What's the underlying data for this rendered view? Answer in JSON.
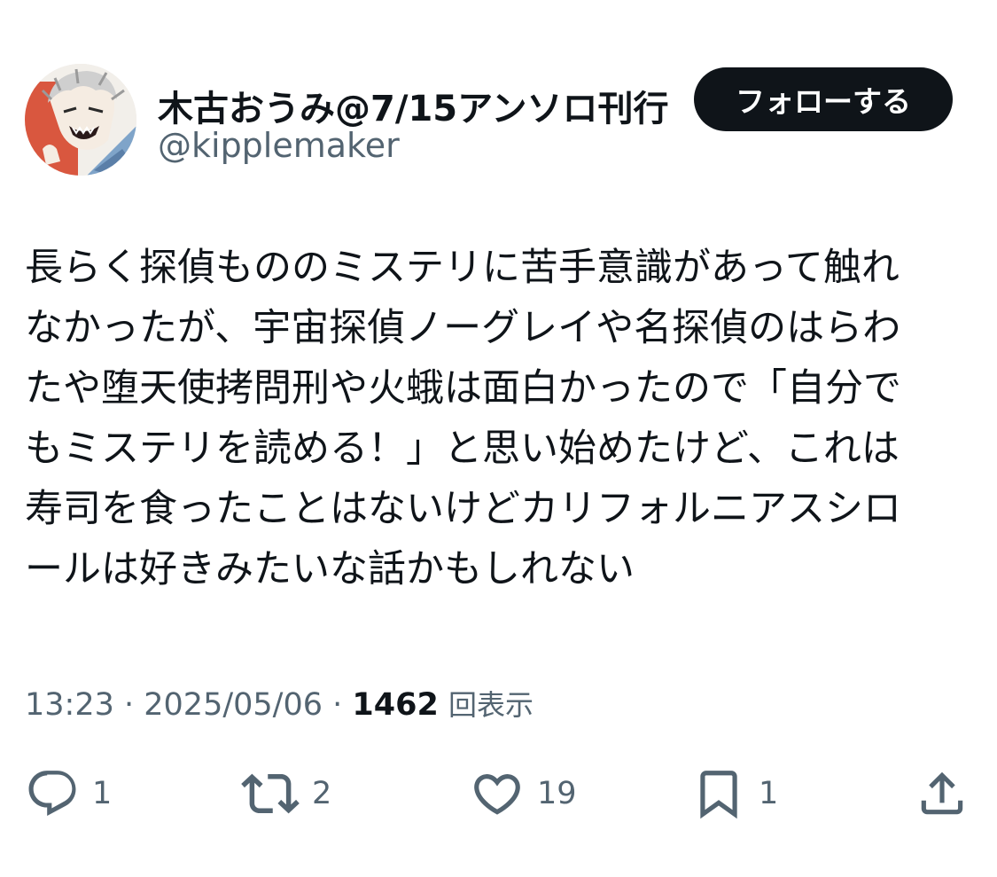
{
  "user": {
    "display_name": "木古おうみ@7/15アンソロ刊行",
    "handle": "@kipplemaker"
  },
  "follow_button": {
    "label": "フォローする"
  },
  "post": {
    "lines": [
      "長らく探偵もののミステリに苦手意識があって触れ",
      "なかったが、宇宙探偵ノーグレイや名探偵のはらわ",
      "たや堕天使拷問刑や火蛾は面白かったので「自分で",
      "もミステリを読める！」と思い始めたけど、これは",
      "寿司を食ったことはないけどカリフォルニアスシロ",
      "ールは好きみたいな話かもしれない"
    ]
  },
  "meta": {
    "time": "13:23",
    "separator1": " · ",
    "date": "2025/05/06",
    "separator2": " · ",
    "views_count": "1462",
    "views_label": "回表示"
  },
  "actions": {
    "reply_count": "1",
    "repost_count": "2",
    "like_count": "19",
    "bookmark_count": "1"
  },
  "icons": {
    "reply": "speech-bubble-icon",
    "repost": "repost-arrows-icon",
    "like": "heart-icon",
    "bookmark": "bookmark-icon",
    "share": "share-upload-icon"
  },
  "colors": {
    "text_primary": "#0f1419",
    "text_secondary": "#536471",
    "follow_button_bg": "#0f1419",
    "follow_button_text": "#ffffff"
  }
}
